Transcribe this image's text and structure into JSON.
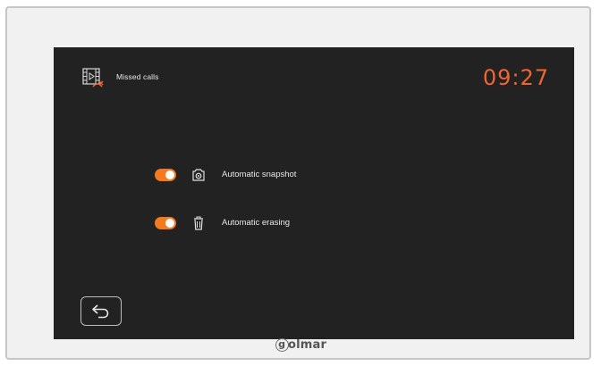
{
  "header": {
    "icon": "missed-calls-video-icon",
    "title": "Missed calls",
    "clock": "09:27"
  },
  "settings": [
    {
      "label": "Automatic snapshot",
      "icon": "camera-icon",
      "enabled": true
    },
    {
      "label": "Automatic erasing",
      "icon": "trash-icon",
      "enabled": true
    }
  ],
  "footer": {
    "back_icon": "back-arrow-icon"
  },
  "brand": {
    "badge_letter": "g",
    "wordmark": "olmar"
  },
  "colors": {
    "accent": "#f26532",
    "toggle_on": "#f47a20",
    "screen_bg": "#222222",
    "text": "#e8e8e8"
  }
}
